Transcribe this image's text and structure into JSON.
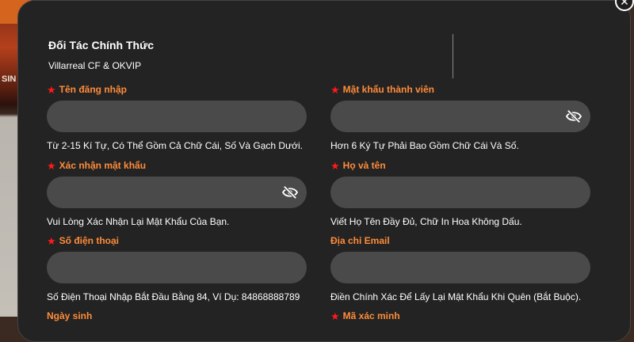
{
  "header": {
    "title": "Đối Tác Chính Thức",
    "subtitle": "Villarreal CF & OKVIP"
  },
  "background": {
    "partial_text": "SIN"
  },
  "close": {
    "icon": "close-icon",
    "glyph": "✕"
  },
  "fields": {
    "username": {
      "label": "Tên đăng nhập",
      "required": true,
      "value": "",
      "hint": "Từ 2-15 Kí Tự, Có Thể Gồm Cả Chữ Cái, Số Và Gạch Dưới."
    },
    "password": {
      "label": "Mật khẩu thành viên",
      "required": true,
      "value": "",
      "hint": "Hơn 6 Ký Tự Phải Bao Gồm Chữ Cái Và Số.",
      "icon": "eye-slash-icon"
    },
    "confirm_password": {
      "label": "Xác nhận mật khẩu",
      "required": true,
      "value": "",
      "hint": "Vui Lòng Xác Nhận Lại Mật Khẩu Của Bạn.",
      "icon": "eye-slash-icon"
    },
    "full_name": {
      "label": "Họ và tên",
      "required": true,
      "value": "",
      "hint": "Viết Họ Tên Đầy Đủ, Chữ In Hoa Không Dấu."
    },
    "phone": {
      "label": "Số điện thoại",
      "required": true,
      "value": "",
      "hint": "Số Điện Thoại Nhập Bắt Đầu Bằng 84, Ví Dụ: 84868888789"
    },
    "email": {
      "label": "Địa chỉ Email",
      "required": false,
      "value": "",
      "hint": "Điền Chính Xác Để Lấy Lại Mật Khẩu Khi Quên (Bắt Buộc)."
    },
    "birthday": {
      "label": "Ngày sinh",
      "required": false
    },
    "captcha": {
      "label": "Mã xác minh",
      "required": true
    }
  },
  "colors": {
    "modal_bg": "#232323",
    "input_bg": "#4a4a4a",
    "label": "#ff8c3a",
    "required_star": "#ff1a1a",
    "text": "#ffffff"
  }
}
